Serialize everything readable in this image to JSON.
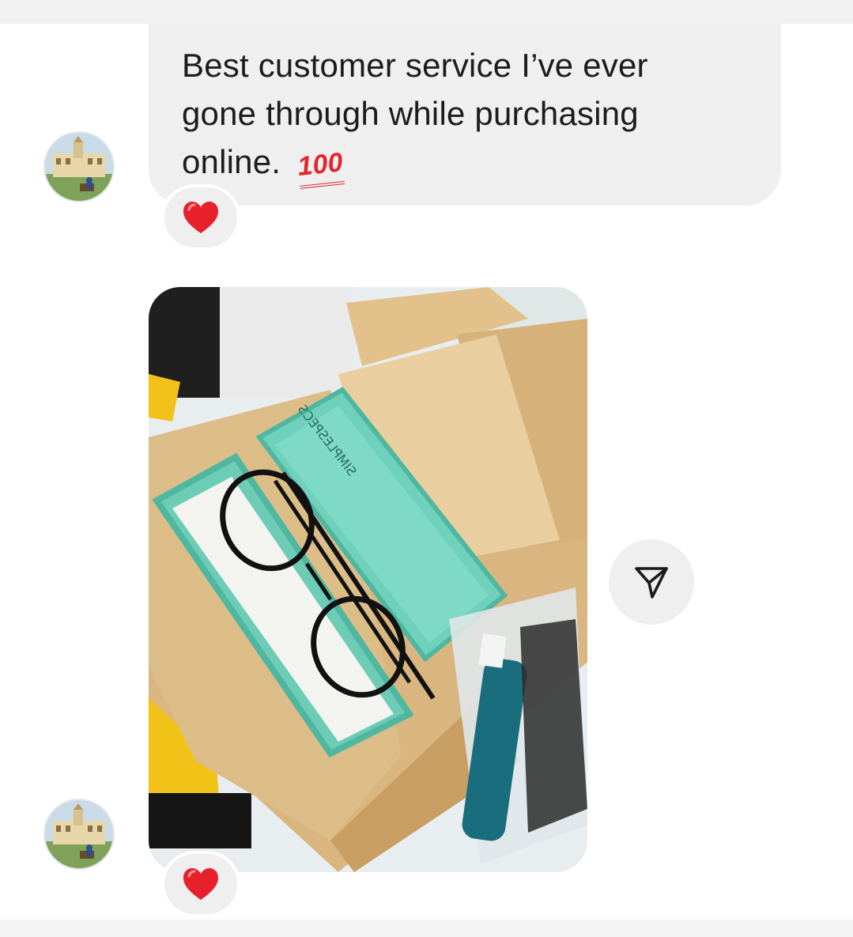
{
  "message": {
    "text": "Best customer service I’ve ever\ngone through while purchasing\nonline.",
    "emoji": "100"
  },
  "photo_message": {
    "case_brand_text": "SIMPLESPECS"
  },
  "reactions": {
    "text_message": "heart-icon",
    "photo_message": "heart-icon"
  },
  "icons": {
    "share": "paper-plane-icon",
    "reaction": "heart-icon"
  },
  "colors": {
    "bubble": "#efefef",
    "heart": "#e8202c",
    "emoji_100": "#e2262d",
    "text": "#1c1c1c"
  }
}
